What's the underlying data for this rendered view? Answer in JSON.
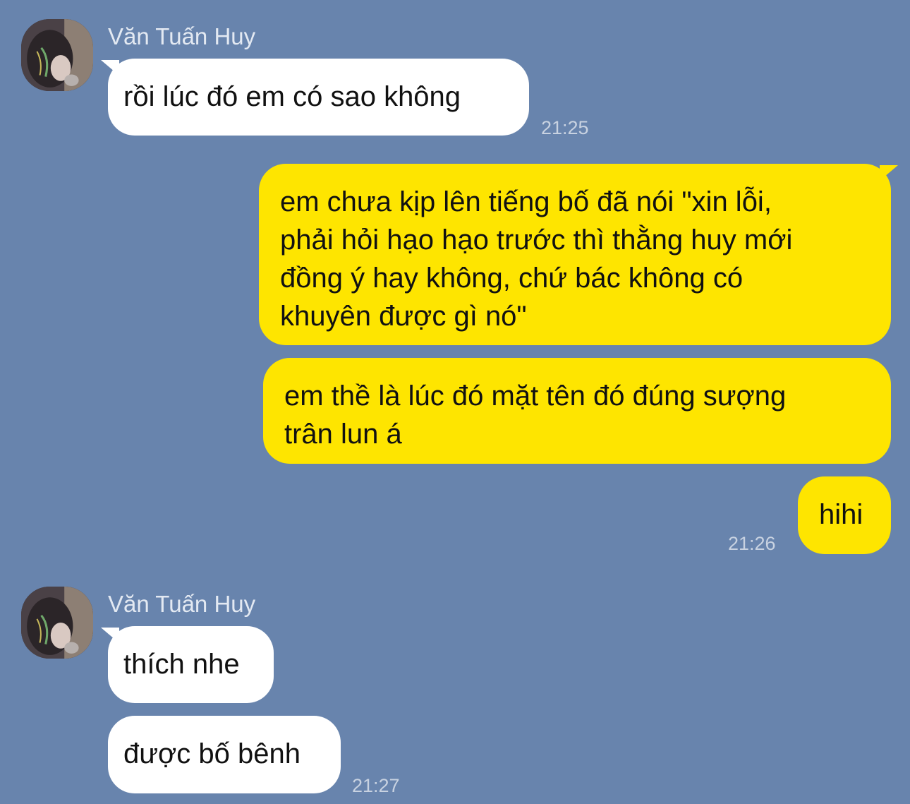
{
  "colors": {
    "background": "#6884ad",
    "incoming_bubble": "#ffffff",
    "outgoing_bubble": "#fee500",
    "timestamp": "#c8d2e1",
    "sender_name": "#e3e9f2"
  },
  "groups": [
    {
      "sender": "Văn Tuấn Huy",
      "avatar_icon": "contact-avatar-photo",
      "messages": [
        {
          "text": "rồi lúc đó em có sao không"
        }
      ],
      "time": "21:25"
    },
    {
      "messages": [
        {
          "lines": [
            "em chưa kịp lên tiếng bố đã nói \"xin lỗi,",
            "phải hỏi hạo hạo trước thì thằng huy mới",
            "đồng ý hay không, chứ bác không có",
            "khuyên được gì nó\""
          ]
        },
        {
          "lines": [
            "em thề là lúc đó mặt tên đó đúng sượng",
            "trân lun á"
          ]
        },
        {
          "text": "hihi"
        }
      ],
      "time": "21:26"
    },
    {
      "sender": "Văn Tuấn Huy",
      "avatar_icon": "contact-avatar-photo",
      "messages": [
        {
          "text": "thích nhe"
        },
        {
          "text": "được bố bênh"
        }
      ],
      "time": "21:27"
    }
  ]
}
